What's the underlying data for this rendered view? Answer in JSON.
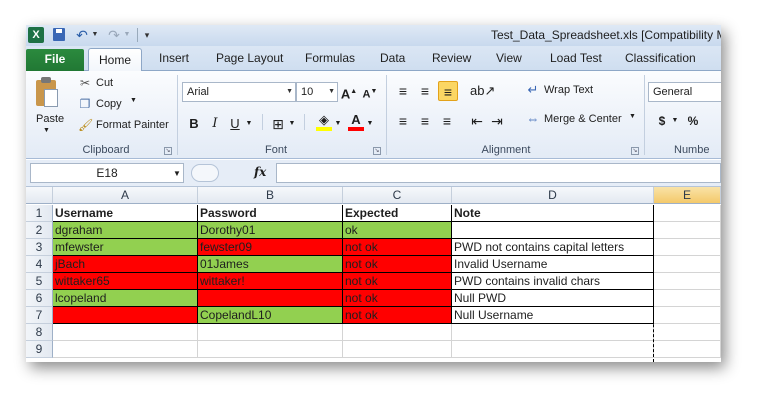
{
  "window": {
    "title": "Test_Data_Spreadsheet.xls  [Compatibility M",
    "app_icon_letter": "X"
  },
  "tabs": [
    "File",
    "Home",
    "Insert",
    "Page Layout",
    "Formulas",
    "Data",
    "Review",
    "View",
    "Load Test",
    "Classification"
  ],
  "ribbon": {
    "clipboard": {
      "paste": "Paste",
      "cut": "Cut",
      "copy": "Copy",
      "format_painter": "Format Painter",
      "label": "Clipboard"
    },
    "font": {
      "name": "Arial",
      "size": "10",
      "bold": "B",
      "italic": "I",
      "underline": "U",
      "label": "Font"
    },
    "alignment": {
      "wrap_text": "Wrap Text",
      "merge_center": "Merge & Center",
      "label": "Alignment"
    },
    "number": {
      "format": "General",
      "currency": "$",
      "percent": "%",
      "label": "Numbe"
    }
  },
  "formula_bar": {
    "name_box": "E18",
    "fx": "fx",
    "value": ""
  },
  "colors": {
    "green": "#92d050",
    "red": "#ff0000",
    "excel_green": "#217834"
  },
  "sheet": {
    "columns": [
      "A",
      "B",
      "C",
      "D",
      "E"
    ],
    "row_numbers": [
      "1",
      "2",
      "3",
      "4",
      "5",
      "6",
      "7",
      "8",
      "9"
    ],
    "rows": [
      [
        "Username",
        "Password",
        "Expected",
        "Note"
      ],
      [
        "dgraham",
        "Dorothy01",
        "ok",
        ""
      ],
      [
        "mfewster",
        "fewster09",
        "not ok",
        "PWD not contains capital letters"
      ],
      [
        "jBach",
        "01James",
        "not ok",
        "Invalid Username"
      ],
      [
        "wittaker65",
        "wittaker!",
        "not ok",
        "PWD contains invalid chars"
      ],
      [
        "lcopeland",
        "",
        "not ok",
        "Null PWD"
      ],
      [
        "",
        "CopelandL10",
        "not ok",
        "Null Username"
      ]
    ],
    "fills": [
      [
        "none",
        "none",
        "none",
        "none"
      ],
      [
        "green",
        "green",
        "green",
        "none"
      ],
      [
        "green",
        "red",
        "red",
        "none"
      ],
      [
        "red",
        "green",
        "red",
        "none"
      ],
      [
        "red",
        "red",
        "red",
        "none"
      ],
      [
        "green",
        "red",
        "red",
        "none"
      ],
      [
        "red",
        "green",
        "red",
        "none"
      ]
    ]
  }
}
